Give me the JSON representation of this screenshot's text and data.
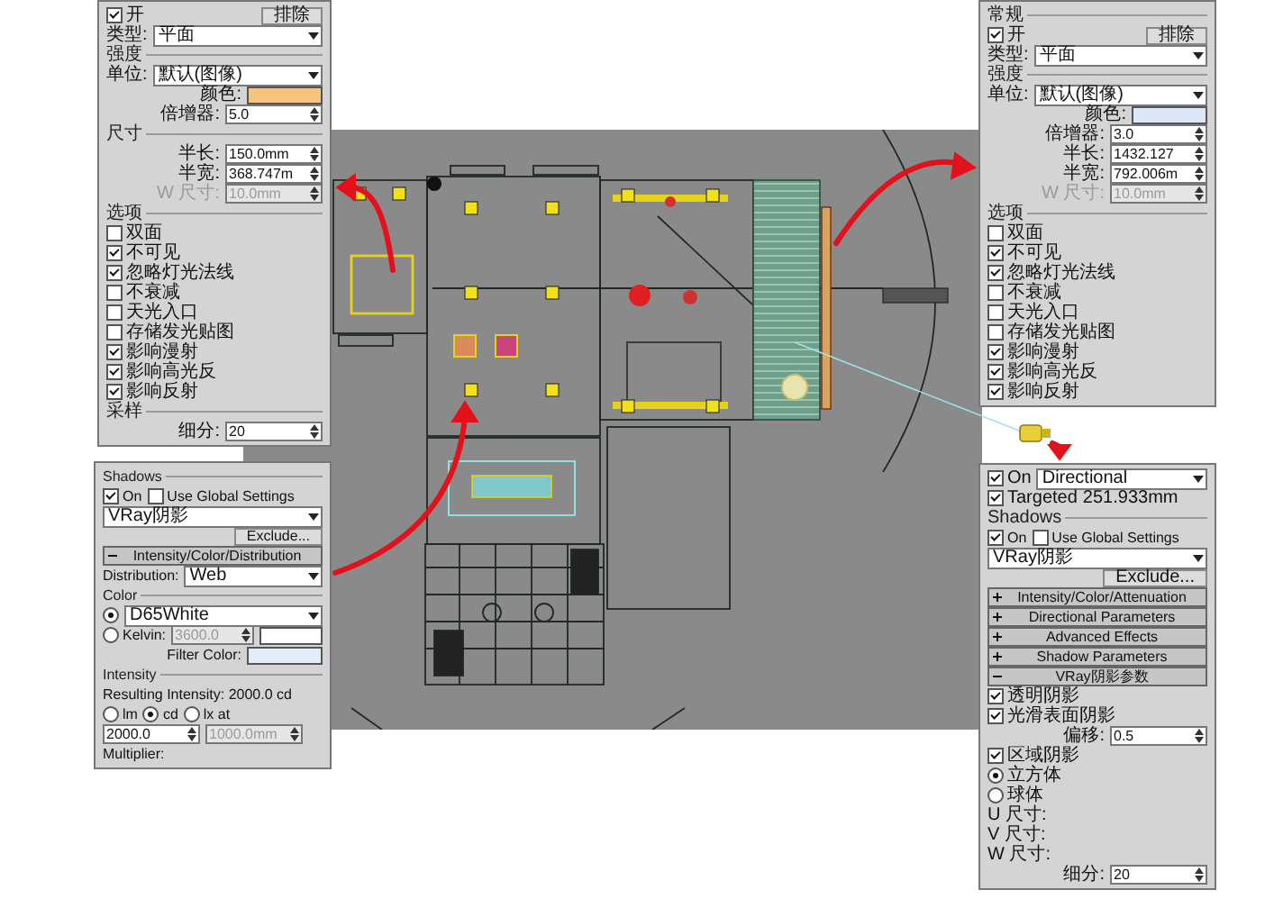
{
  "panels": [
    {
      "rows": [
        {
          "items": [
            {
              "kind": "check",
              "label": "开",
              "checked": true
            },
            {
              "kind": "button",
              "label": "排除"
            }
          ]
        },
        {
          "items": [
            {
              "kind": "label",
              "label": "类型:"
            },
            {
              "kind": "dropdown",
              "value": "平面"
            }
          ]
        },
        {
          "items": [
            {
              "kind": "heading",
              "label": "强度"
            }
          ]
        },
        {
          "items": [
            {
              "kind": "label",
              "label": "单位:"
            },
            {
              "kind": "dropdown",
              "value": "默认(图像)"
            }
          ]
        },
        {
          "items": [
            {
              "kind": "label",
              "label": "颜色:"
            },
            {
              "kind": "swatch",
              "color": "#f6c47e"
            }
          ]
        },
        {
          "items": [
            {
              "kind": "label",
              "label": "倍增器:"
            },
            {
              "kind": "field",
              "value": "5.0",
              "disabled": false
            }
          ]
        },
        {
          "items": [
            {
              "kind": "heading",
              "label": "尺寸"
            }
          ]
        },
        {
          "items": [
            {
              "kind": "label",
              "label": "半长:"
            },
            {
              "kind": "field",
              "value": "150.0mm",
              "disabled": false
            }
          ]
        },
        {
          "items": [
            {
              "kind": "label",
              "label": "半宽:"
            },
            {
              "kind": "field",
              "value": "368.747m",
              "disabled": false
            }
          ]
        },
        {
          "items": [
            {
              "kind": "label",
              "label": "W 尺寸:"
            },
            {
              "kind": "field",
              "value": "10.0mm",
              "disabled": true
            }
          ]
        },
        {
          "items": [
            {
              "kind": "heading",
              "label": "选项"
            }
          ]
        },
        {
          "items": [
            {
              "kind": "check",
              "label": "双面",
              "checked": false
            }
          ]
        },
        {
          "items": [
            {
              "kind": "check",
              "label": "不可见",
              "checked": true
            }
          ]
        },
        {
          "items": [
            {
              "kind": "check",
              "label": "忽略灯光法线",
              "checked": true
            }
          ]
        },
        {
          "items": [
            {
              "kind": "check",
              "label": "不衰减",
              "checked": false
            }
          ]
        },
        {
          "items": [
            {
              "kind": "check",
              "label": "天光入口",
              "checked": false
            }
          ]
        },
        {
          "items": [
            {
              "kind": "check",
              "label": "存储发光贴图",
              "checked": false
            }
          ]
        },
        {
          "items": [
            {
              "kind": "check",
              "label": "影响漫射",
              "checked": true
            }
          ]
        },
        {
          "items": [
            {
              "kind": "check",
              "label": "影响高光反",
              "checked": true
            }
          ]
        },
        {
          "items": [
            {
              "kind": "check",
              "label": "影响反射",
              "checked": true
            }
          ]
        },
        {
          "items": [
            {
              "kind": "heading",
              "label": "采样"
            }
          ]
        },
        {
          "items": [
            {
              "kind": "label",
              "label": "细分:"
            },
            {
              "kind": "field",
              "value": "20",
              "disabled": false
            }
          ]
        }
      ]
    },
    {
      "rows": [
        {
          "items": [
            {
              "kind": "heading",
              "label": "Shadows"
            }
          ]
        },
        {
          "items": [
            {
              "kind": "check",
              "label": "On",
              "checked": true
            },
            {
              "kind": "check",
              "label": "Use Global Settings",
              "checked": false
            }
          ]
        },
        {
          "items": [
            {
              "kind": "dropdown",
              "value": "VRay阴影"
            }
          ]
        },
        {
          "items": [
            {
              "kind": "button",
              "label": "Exclude..."
            }
          ]
        },
        {
          "items": [
            {
              "kind": "rollout",
              "label": "Intensity/Color/Distribution",
              "expanded": true
            }
          ]
        },
        {
          "items": [
            {
              "kind": "label",
              "label": "Distribution:"
            },
            {
              "kind": "dropdown",
              "value": "Web"
            }
          ]
        },
        {
          "items": [
            {
              "kind": "heading",
              "label": "Color"
            }
          ]
        },
        {
          "items": [
            {
              "kind": "radio",
              "selected": true
            },
            {
              "kind": "dropdown",
              "value": "D65White"
            }
          ]
        },
        {
          "items": [
            {
              "kind": "radio",
              "label": "Kelvin:",
              "selected": false
            },
            {
              "kind": "field",
              "value": "3600.0",
              "disabled": true
            },
            {
              "kind": "swatch",
              "color": "#ffffff"
            }
          ]
        },
        {
          "items": [
            {
              "kind": "label",
              "label": "Filter Color:"
            },
            {
              "kind": "swatch",
              "color": "#e4ecf8"
            }
          ]
        },
        {
          "items": [
            {
              "kind": "heading",
              "label": "Intensity"
            }
          ]
        },
        {
          "items": [
            {
              "kind": "label",
              "label": "Resulting Intensity: 2000.0 cd"
            }
          ]
        },
        {
          "items": [
            {
              "kind": "radio",
              "label": "lm",
              "selected": false
            },
            {
              "kind": "radio",
              "label": "cd",
              "selected": true
            },
            {
              "kind": "radio",
              "label": "lx at",
              "selected": false
            }
          ]
        },
        {
          "items": [
            {
              "kind": "field",
              "value": "2000.0",
              "disabled": false
            },
            {
              "kind": "field",
              "value": "1000.0mm",
              "disabled": true
            }
          ]
        },
        {
          "items": [
            {
              "kind": "label",
              "label": "Multiplier:"
            }
          ]
        }
      ]
    },
    {
      "rows": [
        {
          "items": [
            {
              "kind": "heading",
              "label": "常规"
            }
          ]
        },
        {
          "items": [
            {
              "kind": "check",
              "label": "开",
              "checked": true
            },
            {
              "kind": "button",
              "label": "排除"
            }
          ]
        },
        {
          "items": [
            {
              "kind": "label",
              "label": "类型:"
            },
            {
              "kind": "dropdown",
              "value": "平面"
            }
          ]
        },
        {
          "items": [
            {
              "kind": "heading",
              "label": "强度"
            }
          ]
        },
        {
          "items": [
            {
              "kind": "label",
              "label": "单位:"
            },
            {
              "kind": "dropdown",
              "value": "默认(图像)"
            }
          ]
        },
        {
          "items": [
            {
              "kind": "label",
              "label": "颜色:"
            },
            {
              "kind": "swatch",
              "color": "#dce8f8"
            }
          ]
        },
        {
          "items": [
            {
              "kind": "label",
              "label": "倍增器:"
            },
            {
              "kind": "field",
              "value": "3.0",
              "disabled": false
            }
          ]
        },
        {
          "items": [
            {
              "kind": "label",
              "label": "半长:"
            },
            {
              "kind": "field",
              "value": "1432.127",
              "disabled": false
            }
          ]
        },
        {
          "items": [
            {
              "kind": "label",
              "label": "半宽:"
            },
            {
              "kind": "field",
              "value": "792.006m",
              "disabled": false
            }
          ]
        },
        {
          "items": [
            {
              "kind": "label",
              "label": "W 尺寸:"
            },
            {
              "kind": "field",
              "value": "10.0mm",
              "disabled": true
            }
          ]
        },
        {
          "items": [
            {
              "kind": "heading",
              "label": "选项"
            }
          ]
        },
        {
          "items": [
            {
              "kind": "check",
              "label": "双面",
              "checked": false
            }
          ]
        },
        {
          "items": [
            {
              "kind": "check",
              "label": "不可见",
              "checked": true
            }
          ]
        },
        {
          "items": [
            {
              "kind": "check",
              "label": "忽略灯光法线",
              "checked": true
            }
          ]
        },
        {
          "items": [
            {
              "kind": "check",
              "label": "不衰减",
              "checked": false
            }
          ]
        },
        {
          "items": [
            {
              "kind": "check",
              "label": "天光入口",
              "checked": false
            }
          ]
        },
        {
          "items": [
            {
              "kind": "check",
              "label": "存储发光贴图",
              "checked": false
            }
          ]
        },
        {
          "items": [
            {
              "kind": "check",
              "label": "影响漫射",
              "checked": true
            }
          ]
        },
        {
          "items": [
            {
              "kind": "check",
              "label": "影响高光反",
              "checked": true
            }
          ]
        },
        {
          "items": [
            {
              "kind": "check",
              "label": "影响反射",
              "checked": true
            }
          ]
        }
      ]
    },
    {
      "rows": [
        {
          "items": [
            {
              "kind": "check",
              "label": "On",
              "checked": true
            },
            {
              "kind": "dropdown",
              "value": "Directional"
            }
          ]
        },
        {
          "items": [
            {
              "kind": "check",
              "label": "Targeted",
              "checked": true
            },
            {
              "kind": "label",
              "label": "251.933mm"
            }
          ]
        },
        {
          "items": [
            {
              "kind": "heading",
              "label": "Shadows"
            }
          ]
        },
        {
          "items": [
            {
              "kind": "check",
              "label": "On",
              "checked": true
            },
            {
              "kind": "check",
              "label": "Use Global Settings",
              "checked": false
            }
          ]
        },
        {
          "items": [
            {
              "kind": "dropdown",
              "value": "VRay阴影"
            }
          ]
        },
        {
          "items": [
            {
              "kind": "button",
              "label": "Exclude..."
            }
          ]
        },
        {
          "items": [
            {
              "kind": "rollout",
              "label": "Intensity/Color/Attenuation",
              "expanded": false
            }
          ]
        },
        {
          "items": [
            {
              "kind": "rollout",
              "label": "Directional Parameters",
              "expanded": false
            }
          ]
        },
        {
          "items": [
            {
              "kind": "rollout",
              "label": "Advanced Effects",
              "expanded": false
            }
          ]
        },
        {
          "items": [
            {
              "kind": "rollout",
              "label": "Shadow Parameters",
              "expanded": false
            }
          ]
        },
        {
          "items": [
            {
              "kind": "rollout",
              "label": "VRay阴影参数",
              "expanded": true
            }
          ]
        },
        {
          "items": [
            {
              "kind": "check",
              "label": "透明阴影",
              "checked": true
            }
          ]
        },
        {
          "items": [
            {
              "kind": "check",
              "label": "光滑表面阴影",
              "checked": true
            }
          ]
        },
        {
          "items": [
            {
              "kind": "label",
              "label": "偏移:"
            },
            {
              "kind": "field",
              "value": "0.5",
              "disabled": false
            }
          ]
        },
        {
          "items": [
            {
              "kind": "check",
              "label": "区域阴影",
              "checked": true
            }
          ]
        },
        {
          "items": [
            {
              "kind": "radio",
              "label": "立方体",
              "selected": true
            }
          ]
        },
        {
          "items": [
            {
              "kind": "radio",
              "label": "球体",
              "selected": false
            }
          ]
        },
        {
          "items": [
            {
              "kind": "label",
              "label": "U 尺寸:"
            }
          ]
        },
        {
          "items": [
            {
              "kind": "label",
              "label": "V 尺寸:"
            }
          ]
        },
        {
          "items": [
            {
              "kind": "label",
              "label": "W 尺寸:"
            }
          ]
        },
        {
          "items": [
            {
              "kind": "label",
              "label": "细分:"
            },
            {
              "kind": "field",
              "value": "20",
              "disabled": false
            }
          ]
        }
      ]
    }
  ]
}
